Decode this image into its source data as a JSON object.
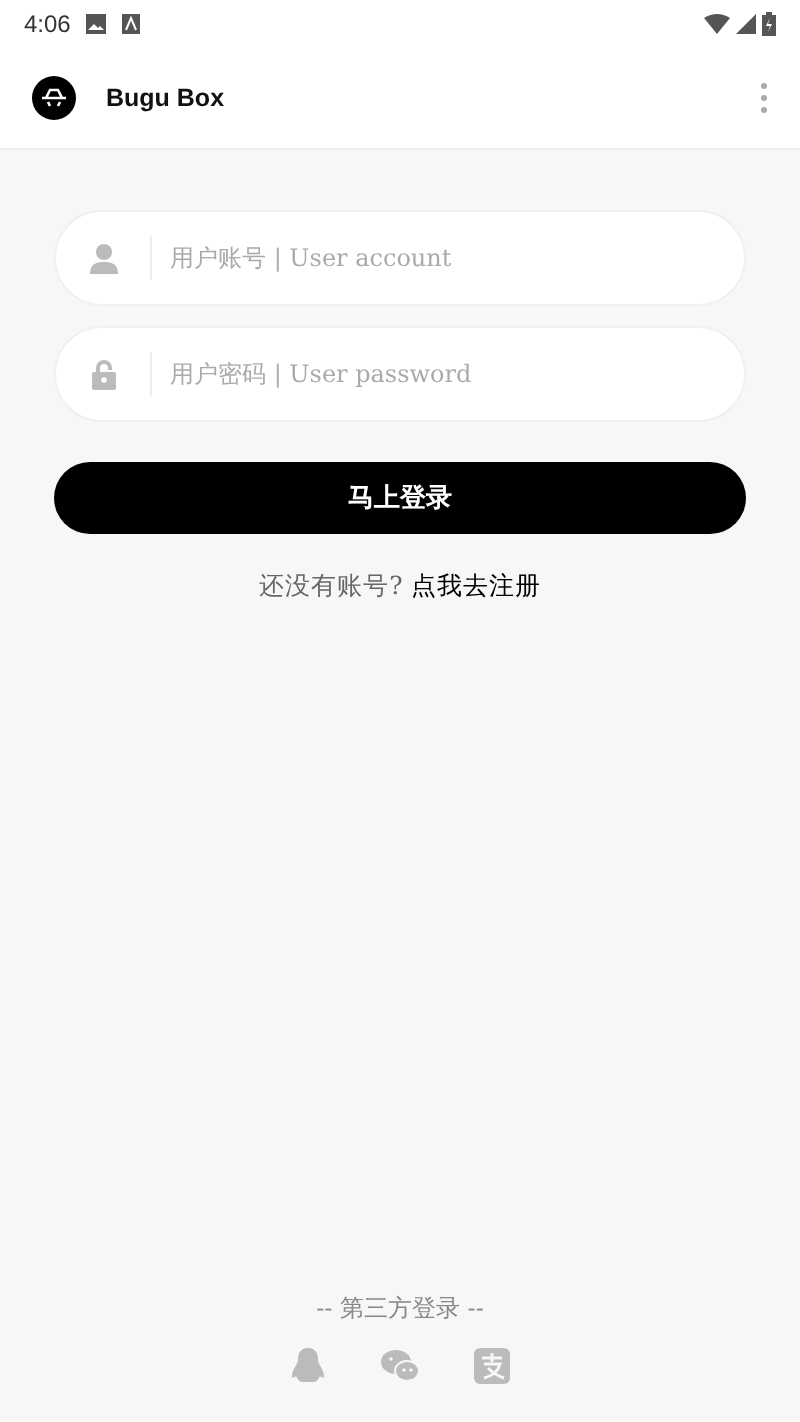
{
  "status_bar": {
    "time": "4:06"
  },
  "app_bar": {
    "title": "Bugu Box"
  },
  "fields": [
    {
      "kind": "account",
      "placeholder": "用户账号 | User account"
    },
    {
      "kind": "password",
      "placeholder": "用户密码 | User password"
    }
  ],
  "login_button": "马上登录",
  "register": {
    "prompt": "还没有账号?",
    "link": "点我去注册"
  },
  "third_party": {
    "title": "-- 第三方登录 --",
    "providers": [
      {
        "kind": "qq"
      },
      {
        "kind": "wechat"
      },
      {
        "kind": "alipay"
      }
    ]
  }
}
